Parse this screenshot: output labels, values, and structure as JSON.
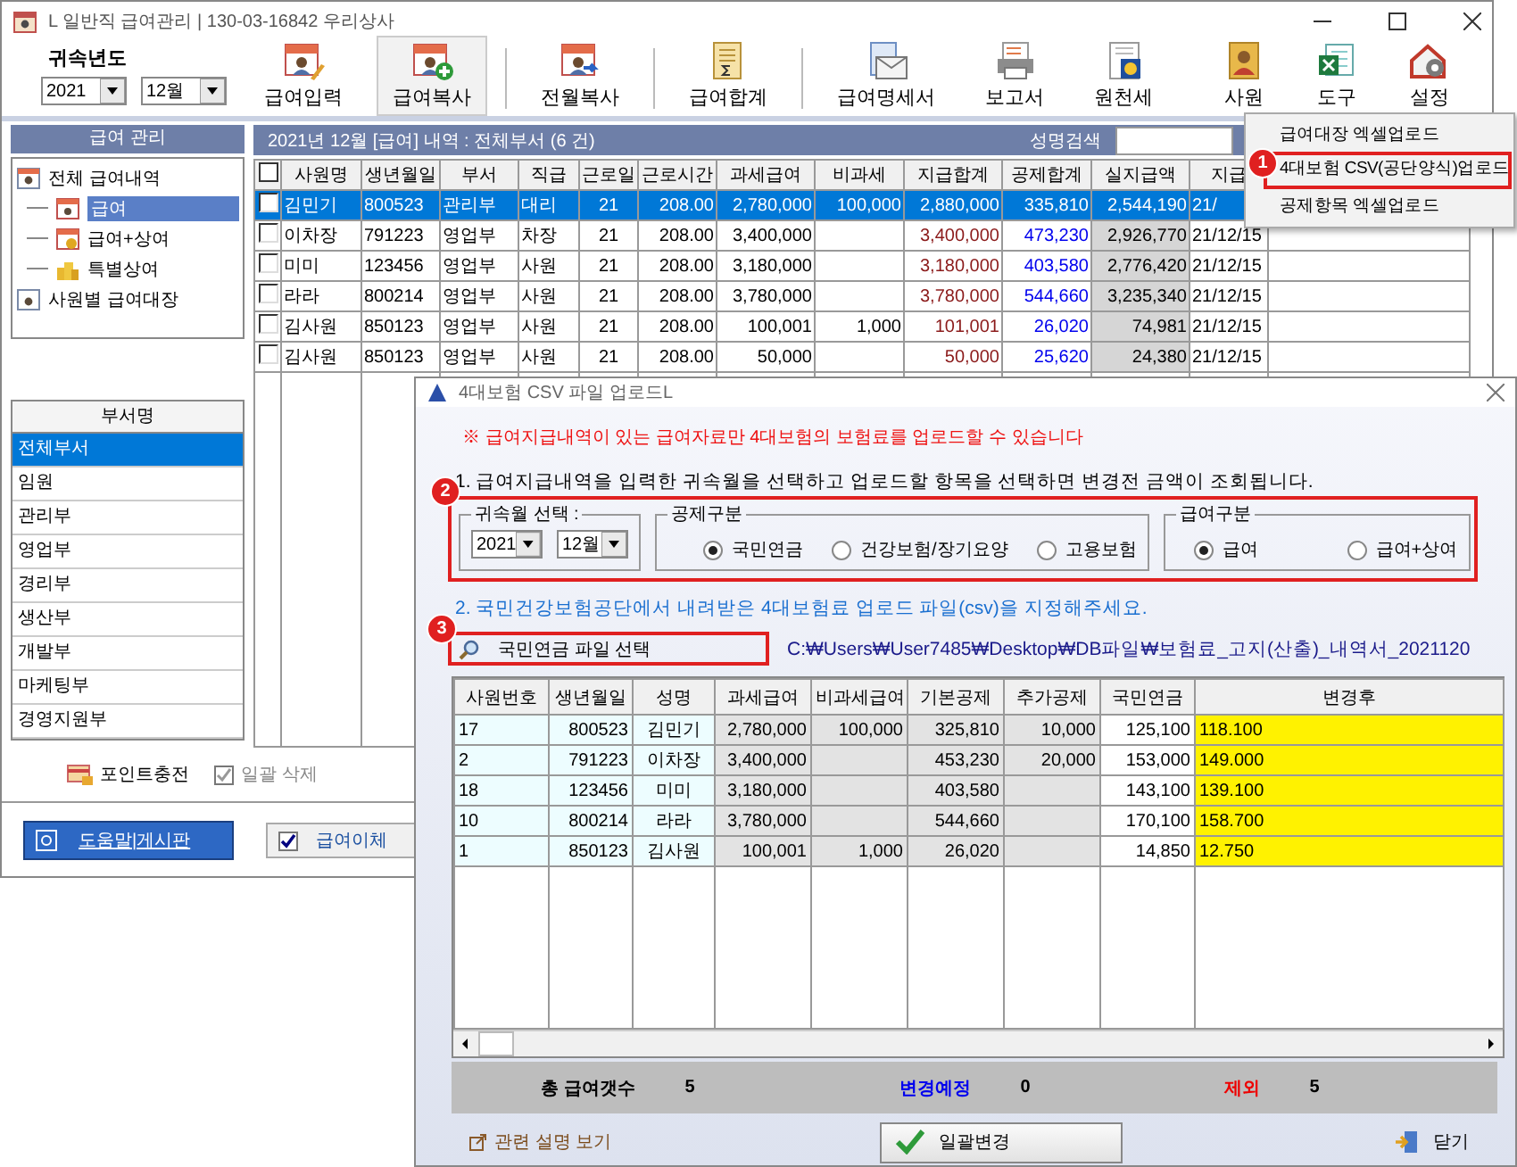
{
  "window": {
    "title": "L 일반직 급여관리 | 130-03-16842  우리상사"
  },
  "toolbar": {
    "year_label": "귀속년도",
    "year": "2021",
    "month": "12월",
    "buttons": [
      {
        "label": "급여입력",
        "kind": "pen",
        "pressed": false
      },
      {
        "label": "급여복사",
        "kind": "add",
        "pressed": true
      },
      {
        "label": "전월복사",
        "kind": "copy",
        "pressed": false
      },
      {
        "label": "급여합계",
        "kind": "sum",
        "pressed": false
      },
      {
        "label": "급여명세서",
        "kind": "mail",
        "pressed": false
      },
      {
        "label": "보고서",
        "kind": "print",
        "pressed": false
      },
      {
        "label": "원천세",
        "kind": "seal",
        "pressed": false
      }
    ],
    "right_buttons": [
      {
        "label": "사원",
        "kind": "person",
        "pressed": false
      },
      {
        "label": "도구",
        "kind": "excel",
        "pressed": false
      },
      {
        "label": "설정",
        "kind": "gear",
        "pressed": false
      }
    ]
  },
  "nav": {
    "title": "급여 관리",
    "tree": [
      {
        "label": "전체 급여내역",
        "kind": "ledger",
        "selected": false,
        "children": [
          {
            "label": "급여",
            "kind": "calendar",
            "selected": true
          },
          {
            "label": "급여+상여",
            "kind": "calendar-coin",
            "selected": false
          },
          {
            "label": "특별상여",
            "kind": "coins",
            "selected": false
          }
        ]
      },
      {
        "label": "사원별 급여대장",
        "kind": "document",
        "selected": false
      }
    ]
  },
  "departments": {
    "title": "부서명",
    "items": [
      {
        "label": "전체부서",
        "selected": true
      },
      {
        "label": "임원",
        "selected": false
      },
      {
        "label": "관리부",
        "selected": false
      },
      {
        "label": "영업부",
        "selected": false
      },
      {
        "label": "경리부",
        "selected": false
      },
      {
        "label": "생산부",
        "selected": false
      },
      {
        "label": "개발부",
        "selected": false
      },
      {
        "label": "마케팅부",
        "selected": false
      },
      {
        "label": "경영지원부",
        "selected": false
      }
    ]
  },
  "point_button": "포인트충전",
  "bulk_delete": {
    "label": "일괄 삭제",
    "checked": true,
    "disabled": true
  },
  "help_button": "도움말|게시판",
  "transfer": {
    "label": "급여이체",
    "checked": true
  },
  "list": {
    "title": "2021년 12월 [급여] 내역 : 전체부서 (6 건)",
    "search_label": "성명검색",
    "header_checked": false,
    "columns": [
      "사원명",
      "생년월일",
      "부서",
      "직급",
      "근로일",
      "근로시간",
      "과세급여",
      "비과세",
      "지급합계",
      "공제합계",
      "실지급액",
      "지급"
    ],
    "rows": [
      {
        "checked": false,
        "selected": true,
        "cells": [
          "김민기",
          "800523",
          "관리부",
          "대리",
          "21",
          "208.00",
          "2,780,000",
          "100,000",
          "2,880,000",
          "335,810",
          "2,544,190",
          "21/"
        ]
      },
      {
        "checked": false,
        "selected": false,
        "cells": [
          "이차장",
          "791223",
          "영업부",
          "차장",
          "21",
          "208.00",
          "3,400,000",
          "",
          "3,400,000",
          "473,230",
          "2,926,770",
          "21/12/15"
        ]
      },
      {
        "checked": false,
        "selected": false,
        "cells": [
          "미미",
          "123456",
          "영업부",
          "사원",
          "21",
          "208.00",
          "3,180,000",
          "",
          "3,180,000",
          "403,580",
          "2,776,420",
          "21/12/15"
        ]
      },
      {
        "checked": false,
        "selected": false,
        "cells": [
          "라라",
          "800214",
          "영업부",
          "사원",
          "21",
          "208.00",
          "3,780,000",
          "",
          "3,780,000",
          "544,660",
          "3,235,340",
          "21/12/15"
        ]
      },
      {
        "checked": false,
        "selected": false,
        "cells": [
          "김사원",
          "850123",
          "영업부",
          "사원",
          "21",
          "208.00",
          "100,001",
          "1,000",
          "101,001",
          "26,020",
          "74,981",
          "21/12/15"
        ]
      },
      {
        "checked": false,
        "selected": false,
        "cells": [
          "김사원",
          "850123",
          "영업부",
          "사원",
          "21",
          "208.00",
          "50,000",
          "",
          "50,000",
          "25,620",
          "24,380",
          "21/12/15"
        ]
      }
    ]
  },
  "menu": {
    "items": [
      {
        "label": "급여대장 엑셀업로드",
        "boxed": false
      },
      {
        "label": "4대보험 CSV(공단양식)업로드",
        "boxed": true,
        "badge": "1"
      },
      {
        "label": "공제항목 엑셀업로드",
        "boxed": false
      }
    ]
  },
  "dialog": {
    "title": "4대보험 CSV 파일 업로드L",
    "warning": "※  급여지급내역이 있는 급여자료만 4대보험의 보험료를 업로드할 수 있습니다",
    "step1": "1. 급여지급내역을 입력한 귀속월을 선택하고 업로드할 항목을 선택하면 변경전 금액이 조회됩니다.",
    "options_badge": "2",
    "period": {
      "legend": "귀속월 선택 :",
      "year": "2021",
      "month": "12월"
    },
    "deduction": {
      "legend": "공제구분",
      "options": [
        {
          "label": "국민연금",
          "selected": true
        },
        {
          "label": "건강보험/장기요양",
          "selected": false
        },
        {
          "label": "고용보험",
          "selected": false
        }
      ]
    },
    "pay_type": {
      "legend": "급여구분",
      "options": [
        {
          "label": "급여",
          "selected": true
        },
        {
          "label": "급여+상여",
          "selected": false
        }
      ]
    },
    "step2": "2. 국민건강보험공단에서 내려받은 4대보험료 업로드 파일(csv)을 지정해주세요.",
    "file_badge": "3",
    "file_button": "국민연금 파일 선택",
    "file_path": "C:₩Users₩User7485₩Desktop₩DB파일₩보험료_고지(산출)_내역서_2021120",
    "table": {
      "columns": [
        "사원번호",
        "생년월일",
        "성명",
        "과세급여",
        "비과세급여",
        "기본공제",
        "추가공제",
        "국민연금",
        "변경후"
      ],
      "rows": [
        [
          "17",
          "800523",
          "김민기",
          "2,780,000",
          "100,000",
          "325,810",
          "10,000",
          "125,100",
          "118.100"
        ],
        [
          "2",
          "791223",
          "이차장",
          "3,400,000",
          "",
          "453,230",
          "20,000",
          "153,000",
          "149.000"
        ],
        [
          "18",
          "123456",
          "미미",
          "3,180,000",
          "",
          "403,580",
          "",
          "143,100",
          "139.100"
        ],
        [
          "10",
          "800214",
          "라라",
          "3,780,000",
          "",
          "544,660",
          "",
          "170,100",
          "158.700"
        ],
        [
          "1",
          "850123",
          "김사원",
          "100,001",
          "1,000",
          "26,020",
          "",
          "14,850",
          "12.750"
        ]
      ]
    },
    "summary": [
      {
        "label": "총 급여갯수",
        "value": "5",
        "kind": "total"
      },
      {
        "label": "변경예정",
        "value": "0",
        "kind": "change"
      },
      {
        "label": "제외",
        "value": "5",
        "kind": "exclude"
      }
    ],
    "help_link": "관련 설명 보기",
    "apply_button": "일괄변경",
    "close_button": "닫기"
  }
}
